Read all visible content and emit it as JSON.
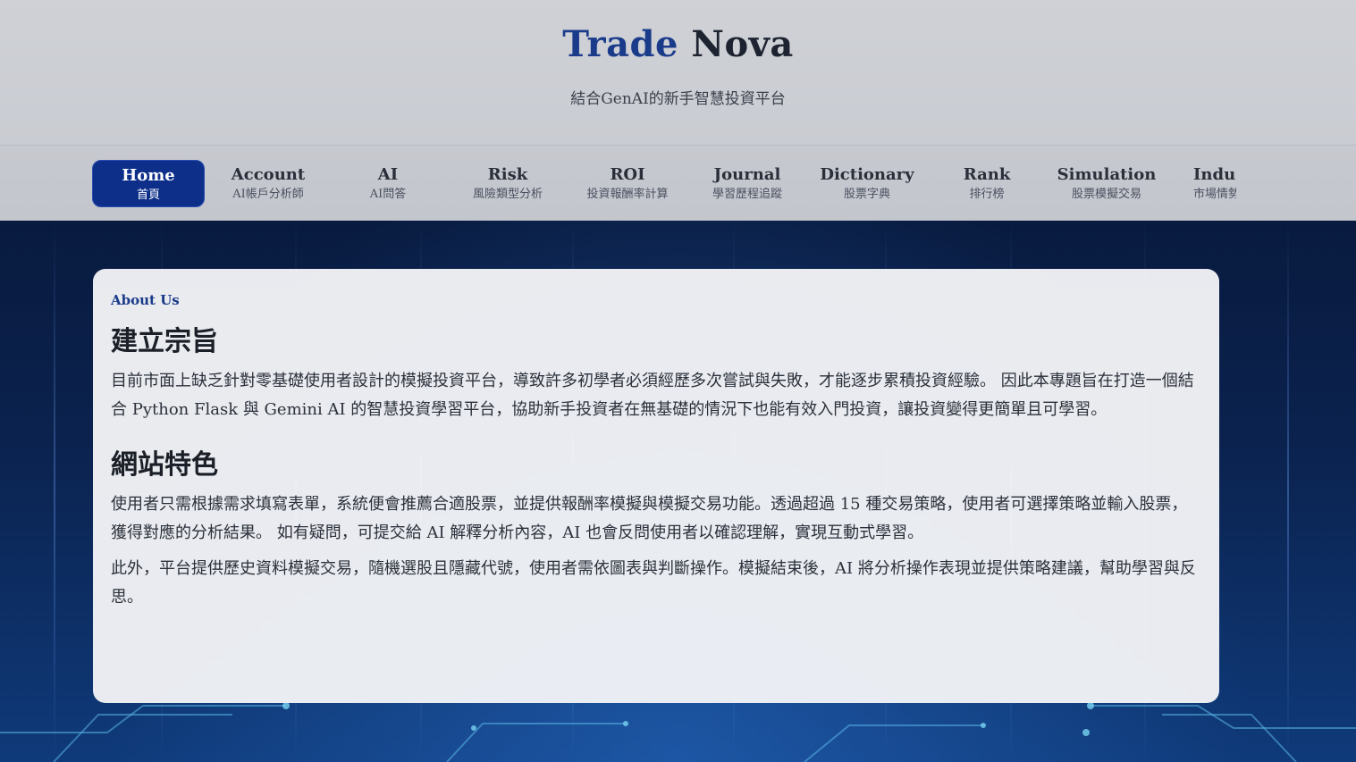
{
  "brand": {
    "part1": "Trade",
    "part2": "Nova"
  },
  "tagline": "結合GenAI的新手智慧投資平台",
  "nav": [
    {
      "en": "Home",
      "zh": "首頁",
      "active": true
    },
    {
      "en": "Account",
      "zh": "AI帳戶分析師",
      "active": false
    },
    {
      "en": "AI",
      "zh": "AI問答",
      "active": false
    },
    {
      "en": "Risk",
      "zh": "風險類型分析",
      "active": false
    },
    {
      "en": "ROI",
      "zh": "投資報酬率計算",
      "active": false
    },
    {
      "en": "Journal",
      "zh": "學習歷程追蹤",
      "active": false
    },
    {
      "en": "Dictionary",
      "zh": "股票字典",
      "active": false
    },
    {
      "en": "Rank",
      "zh": "排行榜",
      "active": false
    },
    {
      "en": "Simulation",
      "zh": "股票模擬交易",
      "active": false
    },
    {
      "en": "Indus",
      "zh": "市場情勢",
      "active": false
    }
  ],
  "about": {
    "eyebrow": "About Us",
    "section1_title": "建立宗旨",
    "section1_text": "目前市面上缺乏針對零基礎使用者設計的模擬投資平台，導致許多初學者必須經歷多次嘗試與失敗，才能逐步累積投資經驗。 因此本專題旨在打造一個結合 Python Flask 與 Gemini AI 的智慧投資學習平台，協助新手投資者在無基礎的情況下也能有效入門投資，讓投資變得更簡單且可學習。",
    "section2_title": "網站特色",
    "section2_text1": "使用者只需根據需求填寫表單，系統便會推薦合適股票，並提供報酬率模擬與模擬交易功能。透過超過 15 種交易策略，使用者可選擇策略並輸入股票，獲得對應的分析結果。 如有疑問，可提交給 AI 解釋分析內容，AI 也會反問使用者以確認理解，實現互動式學習。",
    "section2_text2": "此外，平台提供歷史資料模擬交易，隨機選股且隱藏代號，使用者需依圖表與判斷操作。模擬結束後，AI 將分析操作表現並提供策略建議，幫助學習與反思。"
  },
  "colors": {
    "accent": "#0d2f8a",
    "brand_blue": "#1a3a8a",
    "header_bg": "#cfd1d6",
    "card_bg": "#f1f2f5"
  }
}
